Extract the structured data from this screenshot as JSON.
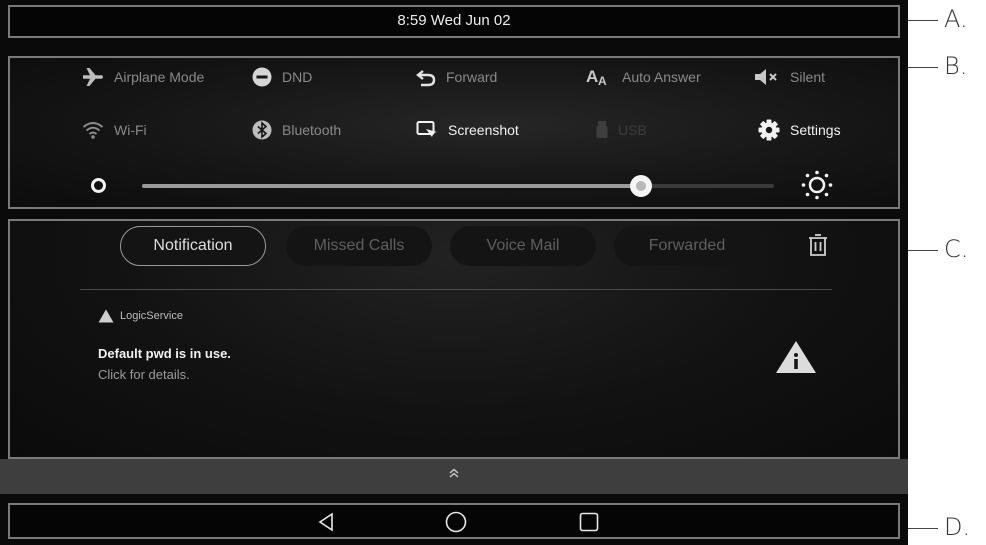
{
  "status_bar": {
    "time": "8:59 Wed Jun 02"
  },
  "quick_settings": {
    "tiles": [
      {
        "label": "Airplane Mode",
        "icon": "airplane-icon",
        "state": "off"
      },
      {
        "label": "DND",
        "icon": "dnd-icon",
        "state": "off"
      },
      {
        "label": "Forward",
        "icon": "forward-icon",
        "state": "off"
      },
      {
        "label": "Auto Answer",
        "icon": "auto-answer-icon",
        "state": "off"
      },
      {
        "label": "Silent",
        "icon": "silent-icon",
        "state": "off"
      },
      {
        "label": "Wi-Fi",
        "icon": "wifi-icon",
        "state": "off"
      },
      {
        "label": "Bluetooth",
        "icon": "bluetooth-icon",
        "state": "off"
      },
      {
        "label": "Screenshot",
        "icon": "screenshot-icon",
        "state": "on"
      },
      {
        "label": "USB",
        "icon": "usb-icon",
        "state": "disabled"
      },
      {
        "label": "Settings",
        "icon": "gear-icon",
        "state": "on"
      }
    ],
    "brightness": {
      "level": 0.79
    }
  },
  "notifications": {
    "tabs": [
      {
        "label": "Notification",
        "active": true
      },
      {
        "label": "Missed Calls",
        "active": false
      },
      {
        "label": "Voice Mail",
        "active": false
      },
      {
        "label": "Forwarded",
        "active": false
      }
    ],
    "items": [
      {
        "source": "LogicService",
        "title": "Default pwd is in use.",
        "subtitle": "Click for details.",
        "icon": "alert-icon"
      }
    ]
  },
  "callouts": {
    "a": "A.",
    "b": "B.",
    "c": "C.",
    "d": "D."
  },
  "colors": {
    "background": "#0a0a0a",
    "frame": "#7a7a7a",
    "handle_bar": "#3e3e3e",
    "text_bright": "#f2f2f2",
    "text_dim": "#8a8a8a"
  }
}
